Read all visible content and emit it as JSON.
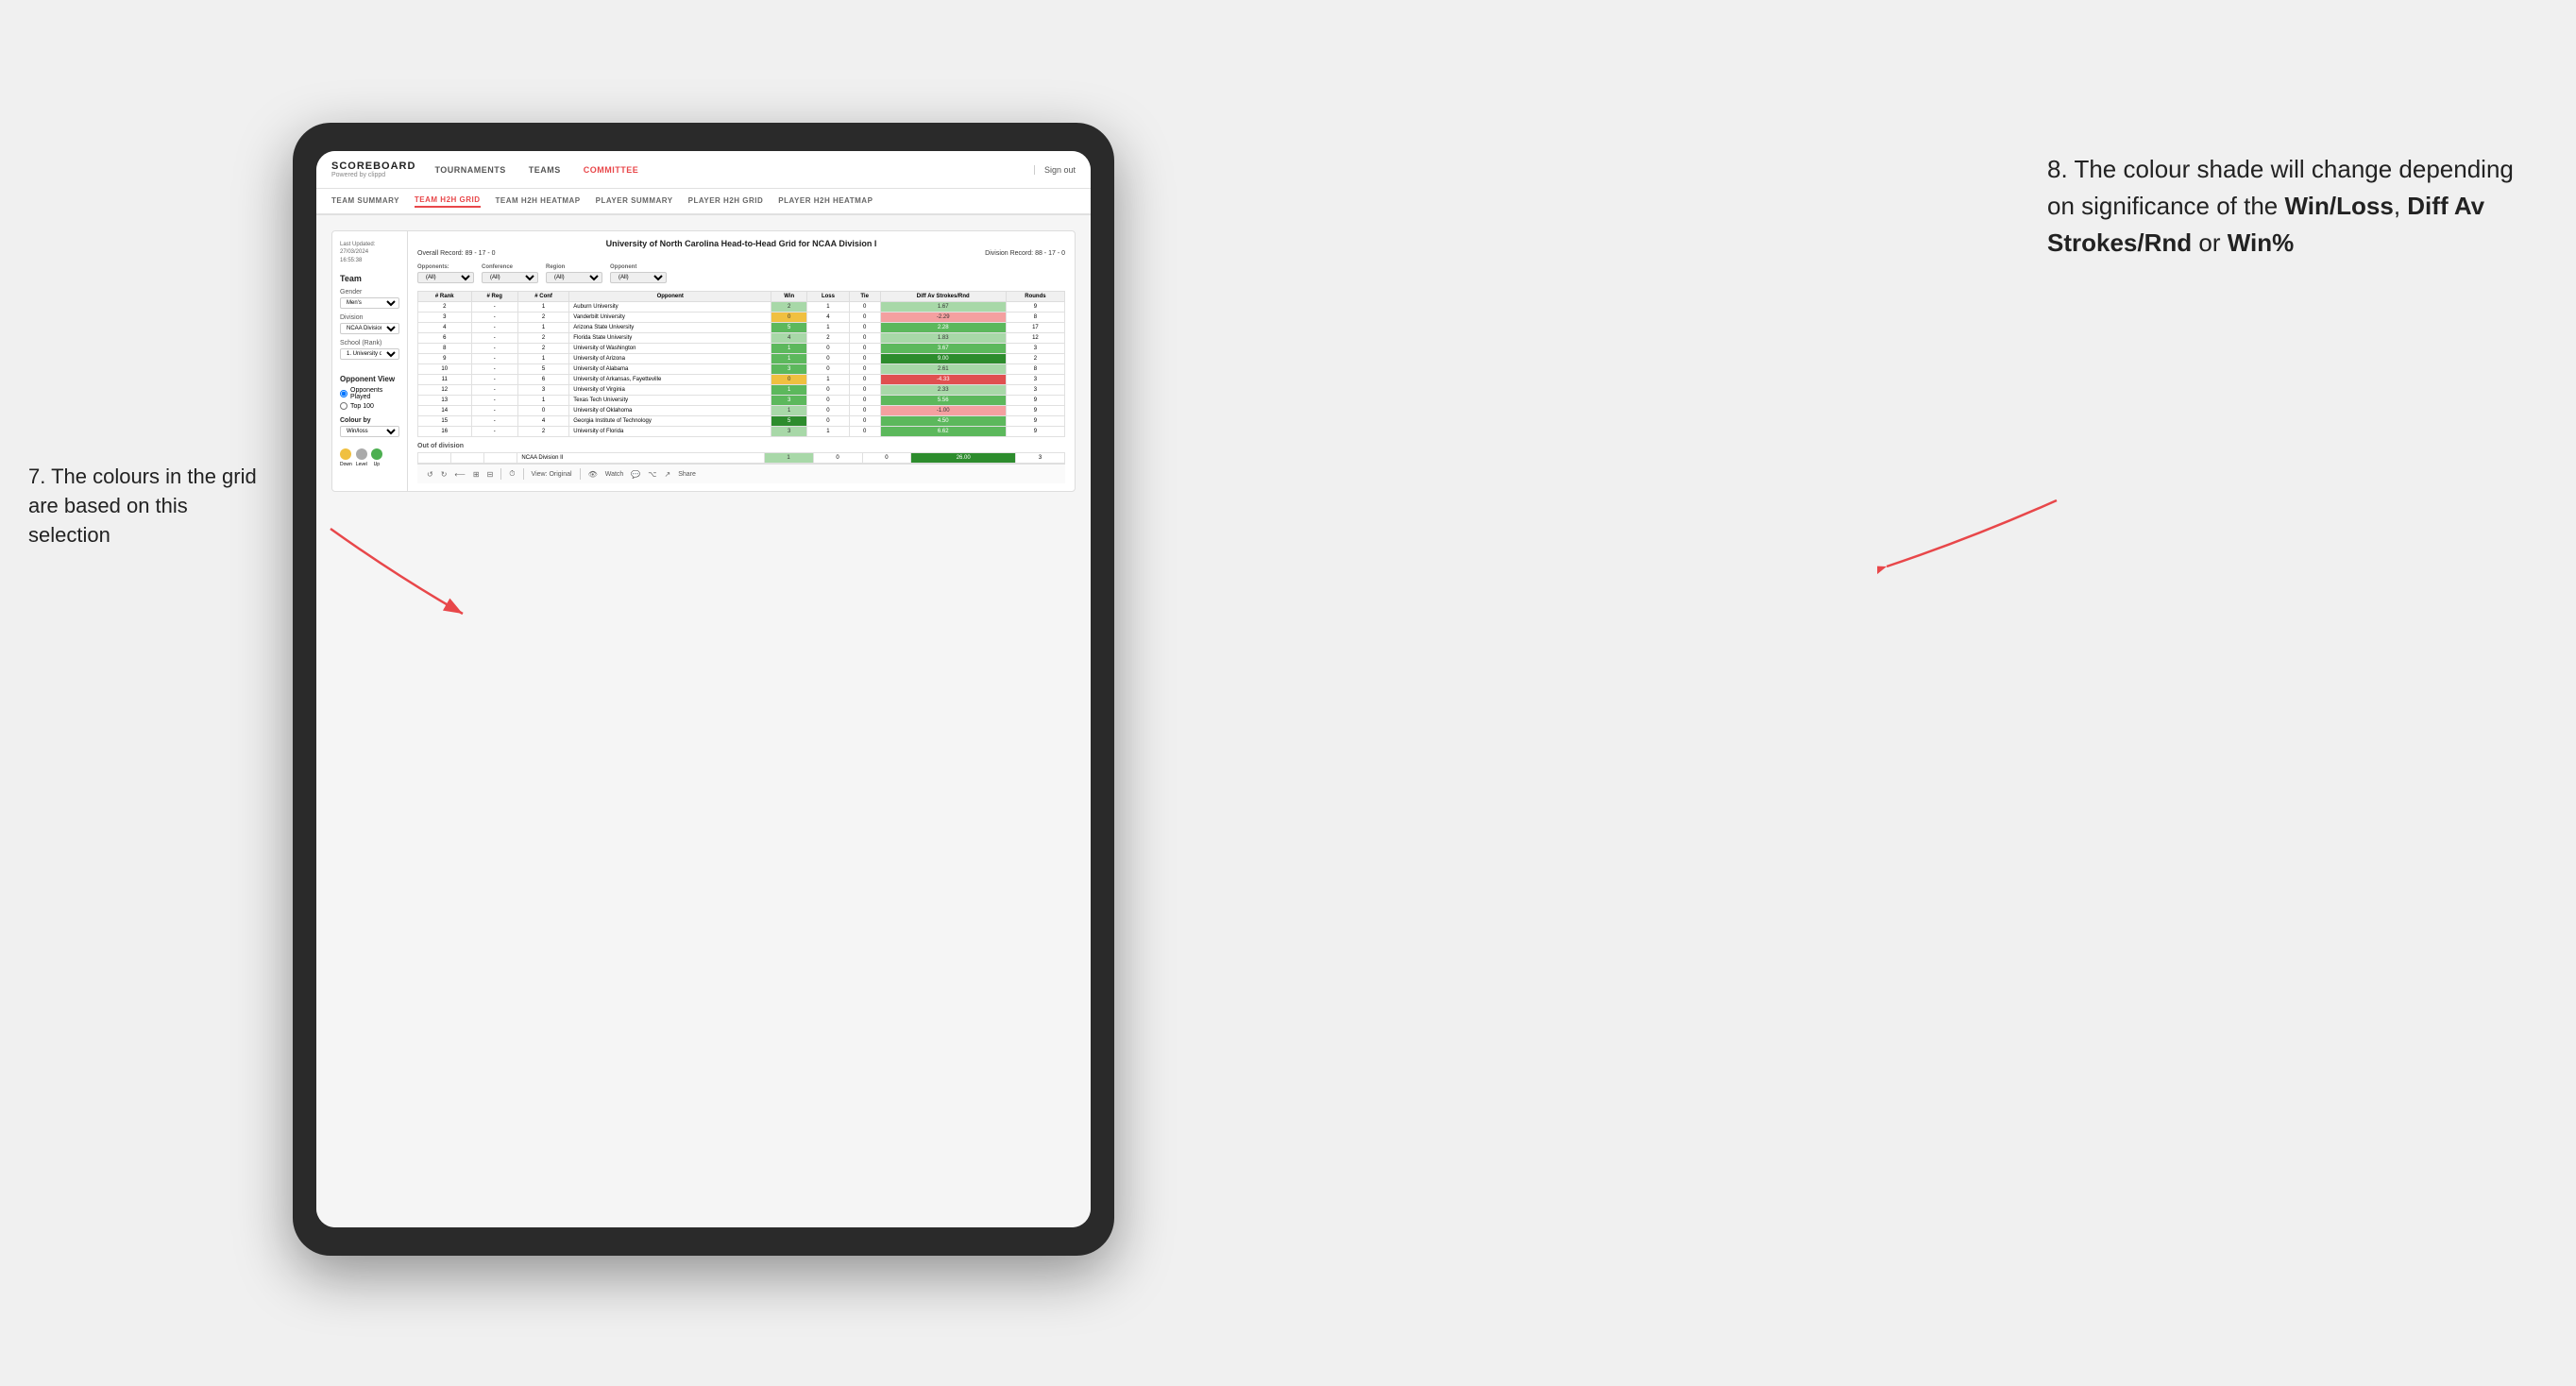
{
  "app": {
    "logo": "SCOREBOARD",
    "logo_sub": "Powered by clippd",
    "sign_out": "Sign out"
  },
  "main_nav": {
    "items": [
      {
        "label": "TOURNAMENTS",
        "active": false
      },
      {
        "label": "TEAMS",
        "active": false
      },
      {
        "label": "COMMITTEE",
        "active": true
      }
    ]
  },
  "sub_nav": {
    "items": [
      {
        "label": "TEAM SUMMARY",
        "active": false
      },
      {
        "label": "TEAM H2H GRID",
        "active": true
      },
      {
        "label": "TEAM H2H HEATMAP",
        "active": false
      },
      {
        "label": "PLAYER SUMMARY",
        "active": false
      },
      {
        "label": "PLAYER H2H GRID",
        "active": false
      },
      {
        "label": "PLAYER H2H HEATMAP",
        "active": false
      }
    ]
  },
  "sidebar": {
    "timestamp_label": "Last Updated: 27/03/2024",
    "timestamp_time": "16:55:38",
    "team_label": "Team",
    "gender_label": "Gender",
    "gender_value": "Men's",
    "division_label": "Division",
    "division_value": "NCAA Division I",
    "school_label": "School (Rank)",
    "school_value": "1. University of Nort...",
    "opponent_view_label": "Opponent View",
    "opponents_played_label": "Opponents Played",
    "top100_label": "Top 100",
    "colour_by_label": "Colour by",
    "colour_by_value": "Win/loss",
    "legend": [
      {
        "label": "Down",
        "color": "#f0c040"
      },
      {
        "label": "Level",
        "color": "#aaaaaa"
      },
      {
        "label": "Up",
        "color": "#4caf50"
      }
    ]
  },
  "grid": {
    "title": "University of North Carolina Head-to-Head Grid for NCAA Division I",
    "overall_record_label": "Overall Record:",
    "overall_record_value": "89 - 17 - 0",
    "division_record_label": "Division Record:",
    "division_record_value": "88 - 17 - 0",
    "filters": {
      "opponents_label": "Opponents:",
      "opponents_value": "(All)",
      "conference_label": "Conference",
      "conference_value": "(All)",
      "region_label": "Region",
      "region_value": "(All)",
      "opponent_label": "Opponent",
      "opponent_value": "(All)"
    },
    "columns": [
      "# Rank",
      "# Reg",
      "# Conf",
      "Opponent",
      "Win",
      "Loss",
      "Tie",
      "Diff Av Strokes/Rnd",
      "Rounds"
    ],
    "rows": [
      {
        "rank": "2",
        "reg": "-",
        "conf": "1",
        "opponent": "Auburn University",
        "win": "2",
        "loss": "1",
        "tie": "0",
        "diff": "1.67",
        "rounds": "9",
        "win_color": "green-light",
        "diff_color": "green-light"
      },
      {
        "rank": "3",
        "reg": "-",
        "conf": "2",
        "opponent": "Vanderbilt University",
        "win": "0",
        "loss": "4",
        "tie": "0",
        "diff": "-2.29",
        "rounds": "8",
        "win_color": "yellow",
        "diff_color": "red-light"
      },
      {
        "rank": "4",
        "reg": "-",
        "conf": "1",
        "opponent": "Arizona State University",
        "win": "5",
        "loss": "1",
        "tie": "0",
        "diff": "2.28",
        "rounds": "17",
        "win_color": "green-mid",
        "diff_color": "green-mid"
      },
      {
        "rank": "6",
        "reg": "-",
        "conf": "2",
        "opponent": "Florida State University",
        "win": "4",
        "loss": "2",
        "tie": "0",
        "diff": "1.83",
        "rounds": "12",
        "win_color": "green-light",
        "diff_color": "green-light"
      },
      {
        "rank": "8",
        "reg": "-",
        "conf": "2",
        "opponent": "University of Washington",
        "win": "1",
        "loss": "0",
        "tie": "0",
        "diff": "3.67",
        "rounds": "3",
        "win_color": "green-mid",
        "diff_color": "green-mid"
      },
      {
        "rank": "9",
        "reg": "-",
        "conf": "1",
        "opponent": "University of Arizona",
        "win": "1",
        "loss": "0",
        "tie": "0",
        "diff": "9.00",
        "rounds": "2",
        "win_color": "green-mid",
        "diff_color": "green-dark"
      },
      {
        "rank": "10",
        "reg": "-",
        "conf": "5",
        "opponent": "University of Alabama",
        "win": "3",
        "loss": "0",
        "tie": "0",
        "diff": "2.61",
        "rounds": "8",
        "win_color": "green-mid",
        "diff_color": "green-light"
      },
      {
        "rank": "11",
        "reg": "-",
        "conf": "6",
        "opponent": "University of Arkansas, Fayetteville",
        "win": "0",
        "loss": "1",
        "tie": "0",
        "diff": "-4.33",
        "rounds": "3",
        "win_color": "yellow",
        "diff_color": "red-mid"
      },
      {
        "rank": "12",
        "reg": "-",
        "conf": "3",
        "opponent": "University of Virginia",
        "win": "1",
        "loss": "0",
        "tie": "0",
        "diff": "2.33",
        "rounds": "3",
        "win_color": "green-mid",
        "diff_color": "green-light"
      },
      {
        "rank": "13",
        "reg": "-",
        "conf": "1",
        "opponent": "Texas Tech University",
        "win": "3",
        "loss": "0",
        "tie": "0",
        "diff": "5.56",
        "rounds": "9",
        "win_color": "green-mid",
        "diff_color": "green-mid"
      },
      {
        "rank": "14",
        "reg": "-",
        "conf": "0",
        "opponent": "University of Oklahoma",
        "win": "1",
        "loss": "0",
        "tie": "0",
        "diff": "-1.00",
        "rounds": "9",
        "win_color": "green-light",
        "diff_color": "red-light"
      },
      {
        "rank": "15",
        "reg": "-",
        "conf": "4",
        "opponent": "Georgia Institute of Technology",
        "win": "5",
        "loss": "0",
        "tie": "0",
        "diff": "4.50",
        "rounds": "9",
        "win_color": "green-dark",
        "diff_color": "green-mid"
      },
      {
        "rank": "16",
        "reg": "-",
        "conf": "2",
        "opponent": "University of Florida",
        "win": "3",
        "loss": "1",
        "tie": "0",
        "diff": "6.62",
        "rounds": "9",
        "win_color": "green-light",
        "diff_color": "green-mid"
      }
    ],
    "out_of_division_label": "Out of division",
    "out_of_division_row": {
      "label": "NCAA Division II",
      "win": "1",
      "loss": "0",
      "tie": "0",
      "diff": "26.00",
      "rounds": "3",
      "diff_color": "green-dark"
    }
  },
  "toolbar": {
    "view_label": "View: Original",
    "watch_label": "Watch",
    "share_label": "Share"
  },
  "annotations": {
    "left": "7. The colours in the grid are based on this selection",
    "right_pre": "8. The colour shade will change depending on significance of the ",
    "bold1": "Win/Loss",
    "sep1": ", ",
    "bold2": "Diff Av Strokes/Rnd",
    "sep2": " or ",
    "bold3": "Win%"
  }
}
